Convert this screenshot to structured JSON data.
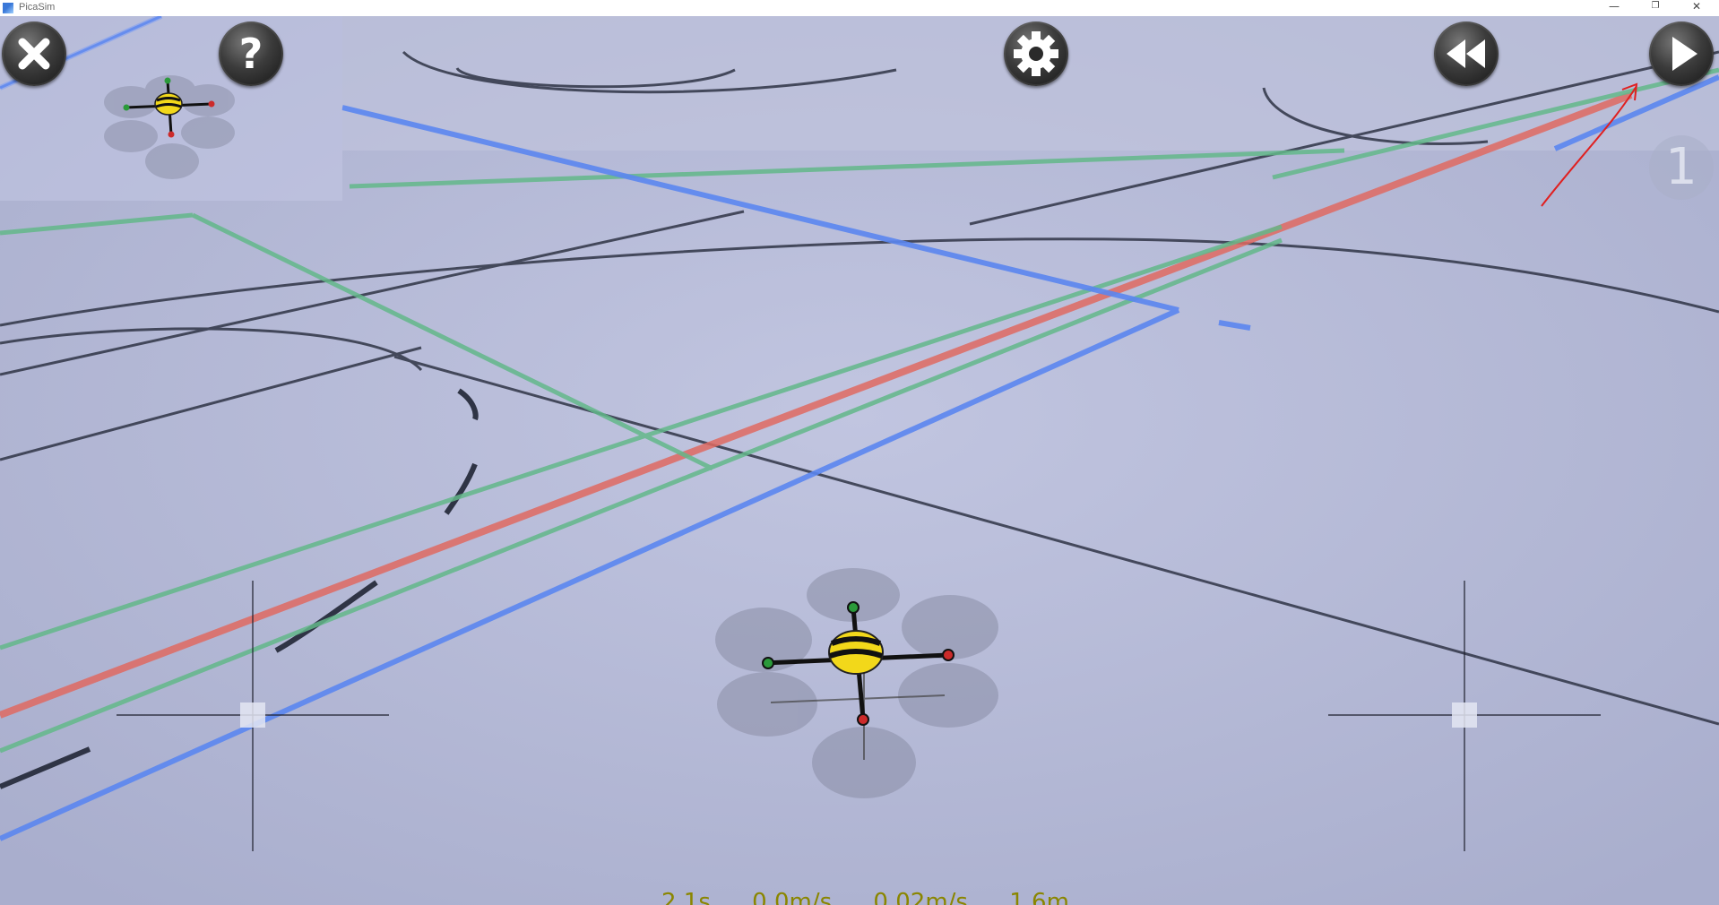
{
  "window": {
    "title": "PicaSim",
    "minimize_glyph": "—",
    "restore_glyph": "❐",
    "close_glyph": "✕"
  },
  "toolbar": {
    "close_icon": "close-icon",
    "help_icon": "help-icon",
    "settings_icon": "gear-icon",
    "rewind_icon": "rewind-icon",
    "play_icon": "play-icon"
  },
  "overlay": {
    "count_badge": "1"
  },
  "status": {
    "time": "2.1s",
    "speed": "0.0m/s",
    "vertical_speed": "0.02m/s",
    "height": "1.6m"
  },
  "colors": {
    "floor": "#b7bcd8",
    "line_blue": "#5b86f0",
    "line_red": "#e06a62",
    "line_green": "#63b88a",
    "line_dark": "#2f3445",
    "status_text": "#8a8600"
  }
}
